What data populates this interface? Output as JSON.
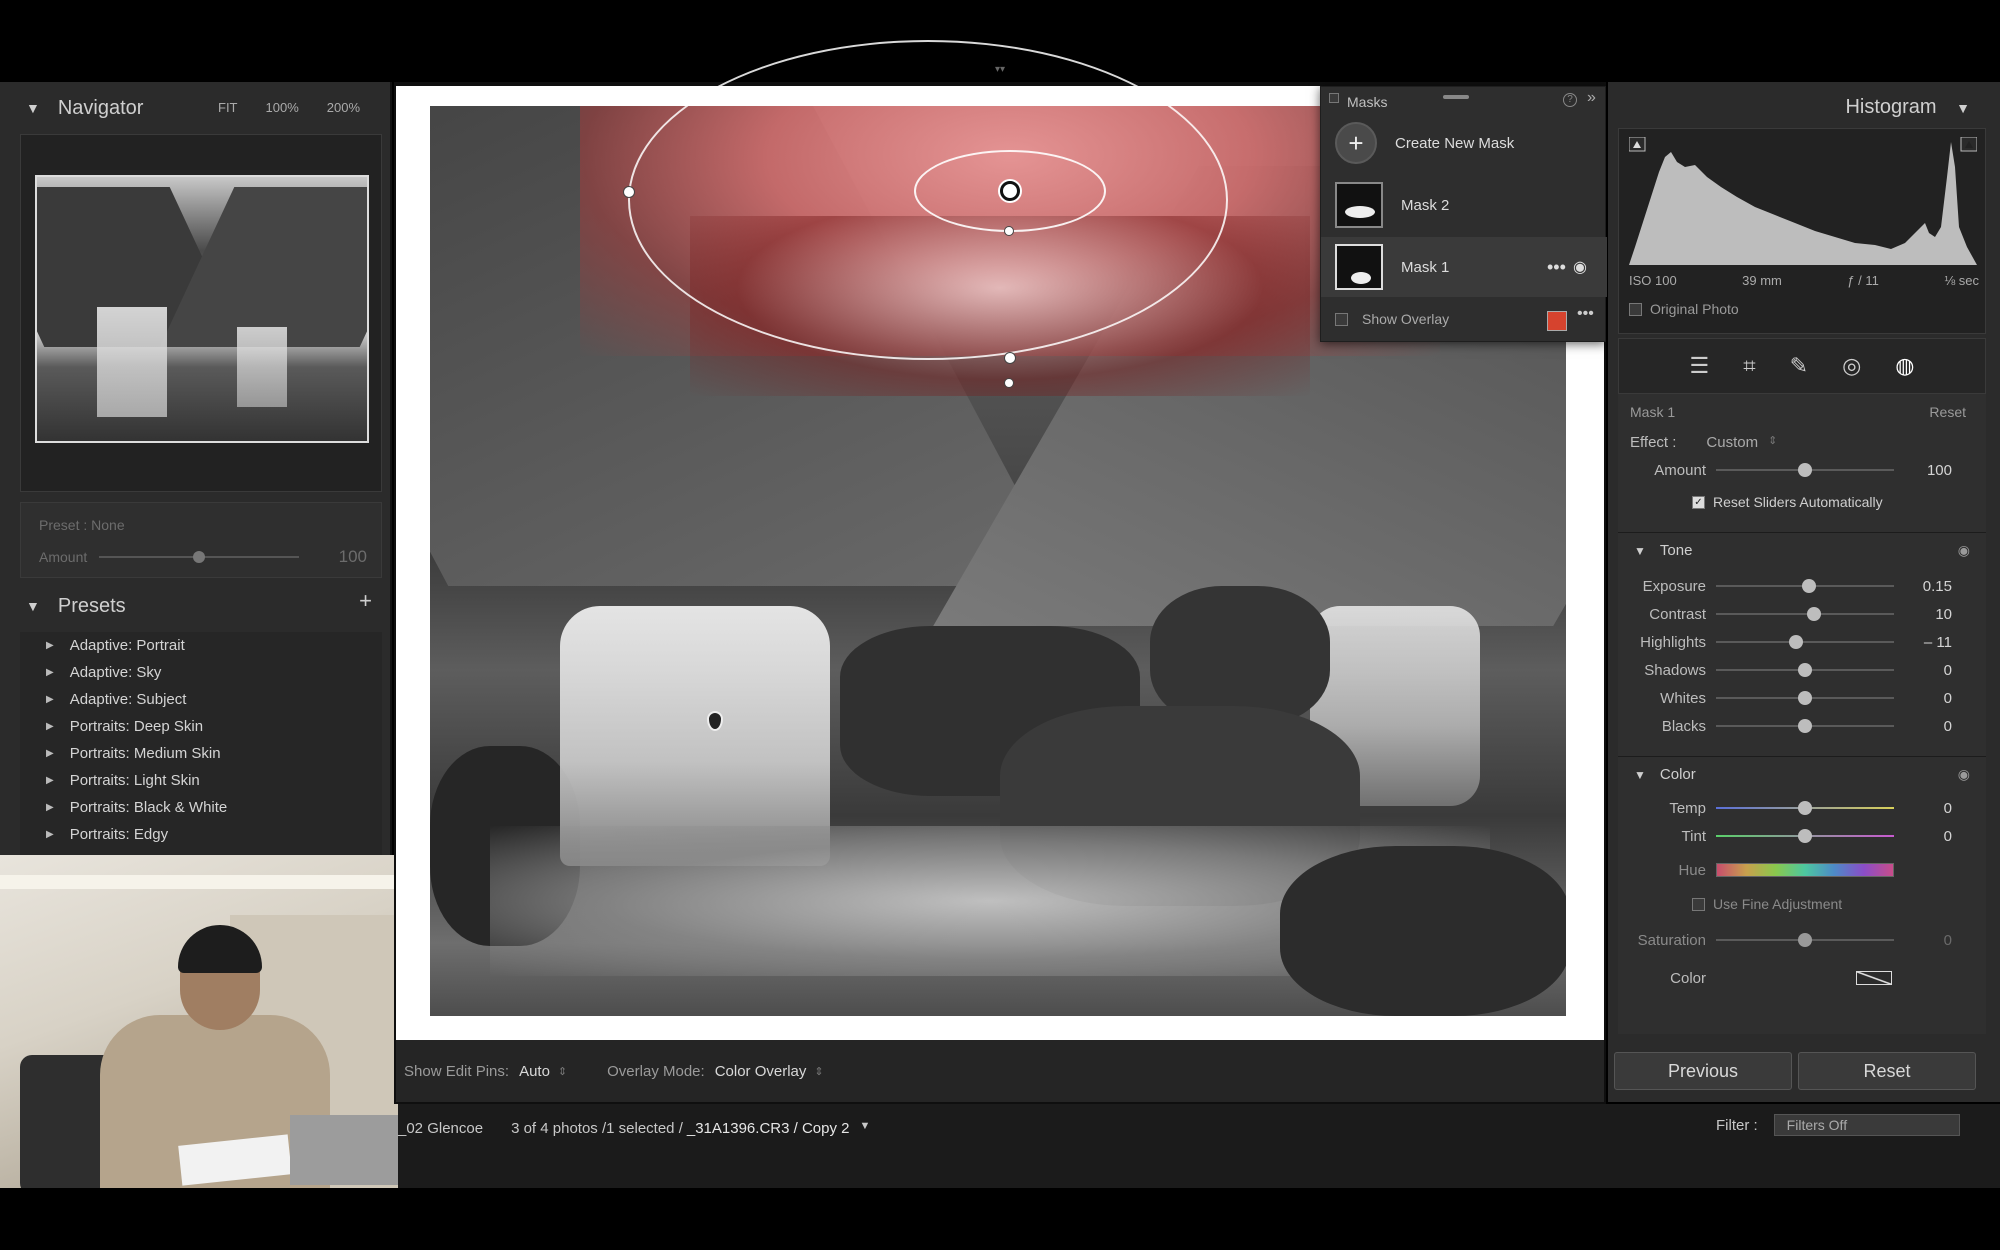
{
  "navigator": {
    "title": "Navigator",
    "zoom": [
      "FIT",
      "100%",
      "200%"
    ]
  },
  "preset_box": {
    "name": "Preset : None",
    "amount_label": "Amount",
    "amount_value": "100",
    "amount_fraction": 0.5
  },
  "presets": {
    "title": "Presets",
    "add": "+",
    "items": [
      "Adaptive: Portrait",
      "Adaptive: Sky",
      "Adaptive: Subject",
      "Portraits: Deep Skin",
      "Portraits: Medium Skin",
      "Portraits: Light Skin",
      "Portraits: Black & White",
      "Portraits: Edgy"
    ]
  },
  "masks_panel": {
    "title": "Masks",
    "help": "?",
    "collapse": "»",
    "create_label": "Create New Mask",
    "items": [
      "Mask 2",
      "Mask 1"
    ],
    "selected": "Mask 1",
    "show_overlay_label": "Show Overlay",
    "overlay_color": "#d6432e"
  },
  "edit_toolbar": {
    "pins_label": "Show Edit Pins:",
    "pins_value": "Auto",
    "overlay_label": "Overlay Mode:",
    "overlay_value": "Color Overlay"
  },
  "histogram": {
    "title": "Histogram",
    "iso": "ISO 100",
    "focal": "39 mm",
    "aperture": "ƒ / 11",
    "shutter": "⅛ sec",
    "original_photo": "Original Photo"
  },
  "tools": [
    "sliders-icon",
    "crop-icon",
    "healing-icon",
    "redeye-icon",
    "masking-icon"
  ],
  "mask_props": {
    "name": "Mask 1",
    "reset": "Reset",
    "effect_label": "Effect :",
    "effect_value": "Custom",
    "amount_label": "Amount",
    "amount_value": "100",
    "reset_sliders": "Reset Sliders Automatically",
    "tone": {
      "title": "Tone",
      "sliders": [
        {
          "label": "Exposure",
          "value": "0.15",
          "pos": 0.52
        },
        {
          "label": "Contrast",
          "value": "10",
          "pos": 0.55
        },
        {
          "label": "Highlights",
          "value": "– 11",
          "pos": 0.45
        },
        {
          "label": "Shadows",
          "value": "0",
          "pos": 0.5
        },
        {
          "label": "Whites",
          "value": "0",
          "pos": 0.5
        },
        {
          "label": "Blacks",
          "value": "0",
          "pos": 0.5
        }
      ]
    },
    "color": {
      "title": "Color",
      "temp_label": "Temp",
      "temp_value": "0",
      "tint_label": "Tint",
      "tint_value": "0",
      "hue_label": "Hue",
      "fine_label": "Use Fine Adjustment",
      "sat_label": "Saturation",
      "sat_value": "0",
      "color_label": "Color"
    }
  },
  "buttons": {
    "previous": "Previous",
    "reset": "Reset"
  },
  "filmstrip": {
    "folder": "_02 Glencoe",
    "info": "3 of 4 photos /1 selected /",
    "file": "_31A1396.CR3 / Copy 2",
    "filter_label": "Filter :",
    "filter_value": "Filters Off"
  }
}
